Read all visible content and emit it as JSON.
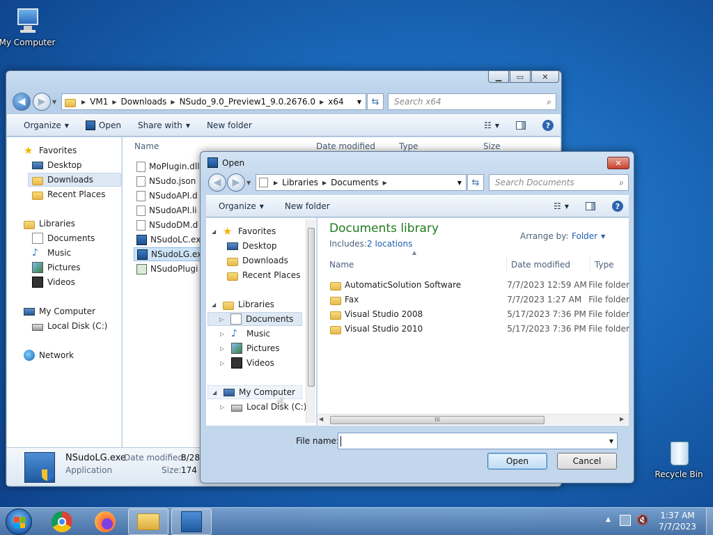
{
  "desktop": {
    "my_computer_label": "My Computer",
    "recycle_bin_label": "Recycle Bin"
  },
  "explorer": {
    "address": [
      "VM1",
      "Downloads",
      "NSudo_9.0_Preview1_9.0.2676.0",
      "x64"
    ],
    "search_placeholder": "Search x64",
    "toolbar": {
      "organize": "Organize",
      "open": "Open",
      "share_with": "Share with",
      "new_folder": "New folder"
    },
    "nav": {
      "favorites": "Favorites",
      "desktop": "Desktop",
      "downloads": "Downloads",
      "recent_places": "Recent Places",
      "libraries": "Libraries",
      "documents": "Documents",
      "music": "Music",
      "pictures": "Pictures",
      "videos": "Videos",
      "my_computer": "My Computer",
      "local_disk": "Local Disk (C:)",
      "network": "Network"
    },
    "columns": {
      "name": "Name",
      "date_modified": "Date modified",
      "type": "Type",
      "size": "Size"
    },
    "files": [
      "MoPlugin.dll",
      "NSudo.json",
      "NSudoAPI.d",
      "NSudoAPI.li",
      "NSudoDM.d",
      "NSudoLC.ex",
      "NSudoLG.ex",
      "NSudoPlugi"
    ],
    "details": {
      "file_name": "NSudoLG.exe",
      "type": "Application",
      "date_label": "Date modified:",
      "date_value": "8/28/",
      "size_label": "Size:",
      "size_value": "174 K"
    }
  },
  "open_dialog": {
    "title": "Open",
    "address": [
      "Libraries",
      "Documents"
    ],
    "search_placeholder": "Search Documents",
    "toolbar": {
      "organize": "Organize",
      "new_folder": "New folder"
    },
    "nav": {
      "favorites": "Favorites",
      "desktop": "Desktop",
      "downloads": "Downloads",
      "recent_places": "Recent Places",
      "libraries": "Libraries",
      "documents": "Documents",
      "music": "Music",
      "pictures": "Pictures",
      "videos": "Videos",
      "my_computer": "My Computer",
      "local_disk": "Local Disk (C:)"
    },
    "library_title": "Documents library",
    "includes_label": "Includes:",
    "locations_link": "2 locations",
    "arrange_by_label": "Arrange by:",
    "arrange_by_value": "Folder",
    "columns": {
      "name": "Name",
      "date_modified": "Date modified",
      "type": "Type"
    },
    "rows": [
      {
        "name": "AutomaticSolution Software",
        "date": "7/7/2023 12:59 AM",
        "type": "File folder"
      },
      {
        "name": "Fax",
        "date": "7/7/2023 1:27 AM",
        "type": "File folder"
      },
      {
        "name": "Visual Studio 2008",
        "date": "5/17/2023 7:36 PM",
        "type": "File folder"
      },
      {
        "name": "Visual Studio 2010",
        "date": "5/17/2023 7:36 PM",
        "type": "File folder"
      }
    ],
    "scroll_grip": "III",
    "file_name_label": "File name:",
    "file_name_value": "",
    "open_button": "Open",
    "cancel_button": "Cancel"
  },
  "taskbar": {
    "time": "1:37 AM",
    "date": "7/7/2023"
  }
}
